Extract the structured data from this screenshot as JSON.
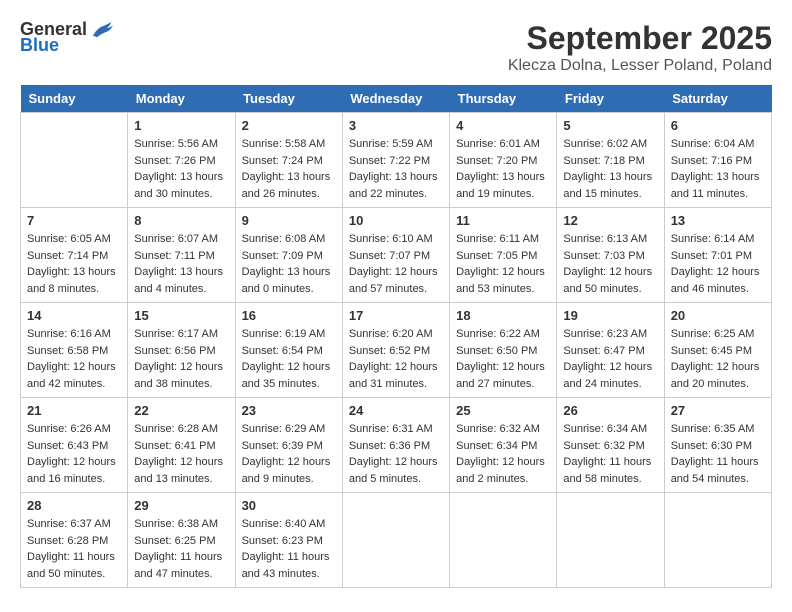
{
  "header": {
    "logo_general": "General",
    "logo_blue": "Blue",
    "title": "September 2025",
    "subtitle": "Klecza Dolna, Lesser Poland, Poland"
  },
  "weekdays": [
    "Sunday",
    "Monday",
    "Tuesday",
    "Wednesday",
    "Thursday",
    "Friday",
    "Saturday"
  ],
  "weeks": [
    [
      {
        "day": "",
        "info": ""
      },
      {
        "day": "1",
        "info": "Sunrise: 5:56 AM\nSunset: 7:26 PM\nDaylight: 13 hours\nand 30 minutes."
      },
      {
        "day": "2",
        "info": "Sunrise: 5:58 AM\nSunset: 7:24 PM\nDaylight: 13 hours\nand 26 minutes."
      },
      {
        "day": "3",
        "info": "Sunrise: 5:59 AM\nSunset: 7:22 PM\nDaylight: 13 hours\nand 22 minutes."
      },
      {
        "day": "4",
        "info": "Sunrise: 6:01 AM\nSunset: 7:20 PM\nDaylight: 13 hours\nand 19 minutes."
      },
      {
        "day": "5",
        "info": "Sunrise: 6:02 AM\nSunset: 7:18 PM\nDaylight: 13 hours\nand 15 minutes."
      },
      {
        "day": "6",
        "info": "Sunrise: 6:04 AM\nSunset: 7:16 PM\nDaylight: 13 hours\nand 11 minutes."
      }
    ],
    [
      {
        "day": "7",
        "info": "Sunrise: 6:05 AM\nSunset: 7:14 PM\nDaylight: 13 hours\nand 8 minutes."
      },
      {
        "day": "8",
        "info": "Sunrise: 6:07 AM\nSunset: 7:11 PM\nDaylight: 13 hours\nand 4 minutes."
      },
      {
        "day": "9",
        "info": "Sunrise: 6:08 AM\nSunset: 7:09 PM\nDaylight: 13 hours\nand 0 minutes."
      },
      {
        "day": "10",
        "info": "Sunrise: 6:10 AM\nSunset: 7:07 PM\nDaylight: 12 hours\nand 57 minutes."
      },
      {
        "day": "11",
        "info": "Sunrise: 6:11 AM\nSunset: 7:05 PM\nDaylight: 12 hours\nand 53 minutes."
      },
      {
        "day": "12",
        "info": "Sunrise: 6:13 AM\nSunset: 7:03 PM\nDaylight: 12 hours\nand 50 minutes."
      },
      {
        "day": "13",
        "info": "Sunrise: 6:14 AM\nSunset: 7:01 PM\nDaylight: 12 hours\nand 46 minutes."
      }
    ],
    [
      {
        "day": "14",
        "info": "Sunrise: 6:16 AM\nSunset: 6:58 PM\nDaylight: 12 hours\nand 42 minutes."
      },
      {
        "day": "15",
        "info": "Sunrise: 6:17 AM\nSunset: 6:56 PM\nDaylight: 12 hours\nand 38 minutes."
      },
      {
        "day": "16",
        "info": "Sunrise: 6:19 AM\nSunset: 6:54 PM\nDaylight: 12 hours\nand 35 minutes."
      },
      {
        "day": "17",
        "info": "Sunrise: 6:20 AM\nSunset: 6:52 PM\nDaylight: 12 hours\nand 31 minutes."
      },
      {
        "day": "18",
        "info": "Sunrise: 6:22 AM\nSunset: 6:50 PM\nDaylight: 12 hours\nand 27 minutes."
      },
      {
        "day": "19",
        "info": "Sunrise: 6:23 AM\nSunset: 6:47 PM\nDaylight: 12 hours\nand 24 minutes."
      },
      {
        "day": "20",
        "info": "Sunrise: 6:25 AM\nSunset: 6:45 PM\nDaylight: 12 hours\nand 20 minutes."
      }
    ],
    [
      {
        "day": "21",
        "info": "Sunrise: 6:26 AM\nSunset: 6:43 PM\nDaylight: 12 hours\nand 16 minutes."
      },
      {
        "day": "22",
        "info": "Sunrise: 6:28 AM\nSunset: 6:41 PM\nDaylight: 12 hours\nand 13 minutes."
      },
      {
        "day": "23",
        "info": "Sunrise: 6:29 AM\nSunset: 6:39 PM\nDaylight: 12 hours\nand 9 minutes."
      },
      {
        "day": "24",
        "info": "Sunrise: 6:31 AM\nSunset: 6:36 PM\nDaylight: 12 hours\nand 5 minutes."
      },
      {
        "day": "25",
        "info": "Sunrise: 6:32 AM\nSunset: 6:34 PM\nDaylight: 12 hours\nand 2 minutes."
      },
      {
        "day": "26",
        "info": "Sunrise: 6:34 AM\nSunset: 6:32 PM\nDaylight: 11 hours\nand 58 minutes."
      },
      {
        "day": "27",
        "info": "Sunrise: 6:35 AM\nSunset: 6:30 PM\nDaylight: 11 hours\nand 54 minutes."
      }
    ],
    [
      {
        "day": "28",
        "info": "Sunrise: 6:37 AM\nSunset: 6:28 PM\nDaylight: 11 hours\nand 50 minutes."
      },
      {
        "day": "29",
        "info": "Sunrise: 6:38 AM\nSunset: 6:25 PM\nDaylight: 11 hours\nand 47 minutes."
      },
      {
        "day": "30",
        "info": "Sunrise: 6:40 AM\nSunset: 6:23 PM\nDaylight: 11 hours\nand 43 minutes."
      },
      {
        "day": "",
        "info": ""
      },
      {
        "day": "",
        "info": ""
      },
      {
        "day": "",
        "info": ""
      },
      {
        "day": "",
        "info": ""
      }
    ]
  ]
}
